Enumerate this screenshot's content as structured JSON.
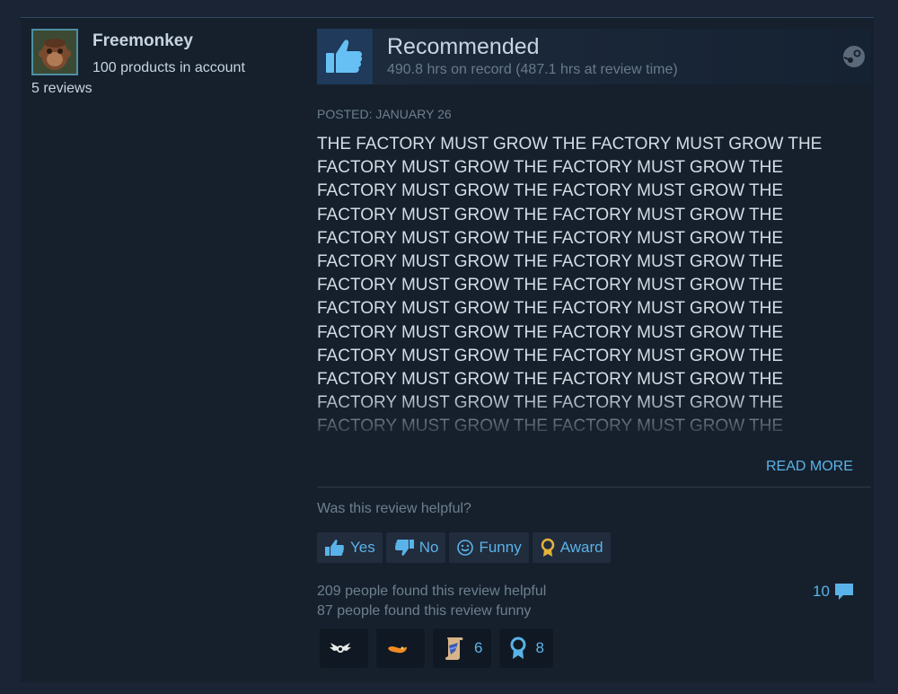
{
  "author": {
    "name": "Freemonkey",
    "products": "100 products in account",
    "reviews": "5 reviews"
  },
  "review": {
    "vote": "Recommended",
    "hours": "490.8 hrs on record (487.1 hrs at review time)",
    "posted": "POSTED: JANUARY 26",
    "content": "THE FACTORY MUST GROW THE FACTORY MUST GROW THE FACTORY MUST GROW THE FACTORY MUST GROW THE FACTORY MUST GROW THE FACTORY MUST GROW THE FACTORY MUST GROW THE FACTORY MUST GROW THE FACTORY MUST GROW THE FACTORY MUST GROW THE FACTORY MUST GROW THE FACTORY MUST GROW THE FACTORY MUST GROW THE FACTORY MUST GROW THE FACTORY MUST GROW THE FACTORY MUST GROW THE FACTORY MUST GROW THE FACTORY MUST GROW THE FACTORY MUST GROW THE FACTORY MUST GROW THE FACTORY MUST GROW THE FACTORY MUST GROW THE FACTORY MUST GROW THE FACTORY MUST GROW THE FACTORY MUST GROW THE FACTORY MUST GROW THE",
    "read_more": "READ MORE"
  },
  "feedback": {
    "question": "Was this review helpful?",
    "yes": "Yes",
    "no": "No",
    "funny": "Funny",
    "award": "Award",
    "helpful_count": "209 people found this review helpful",
    "funny_count": "87 people found this review funny",
    "comments": "10"
  },
  "awards": [
    {
      "icon": "winged-award-icon",
      "count": ""
    },
    {
      "icon": "hot-take-award-icon",
      "count": ""
    },
    {
      "icon": "scroll-award-icon",
      "count": "6"
    },
    {
      "icon": "ribbon-award-icon",
      "count": "8"
    }
  ],
  "colors": {
    "accent": "#5ab3e8",
    "page_bg": "#1b2434",
    "card_bg": "#16202d",
    "text": "#c7d5e0",
    "muted": "#6d7f8e"
  }
}
